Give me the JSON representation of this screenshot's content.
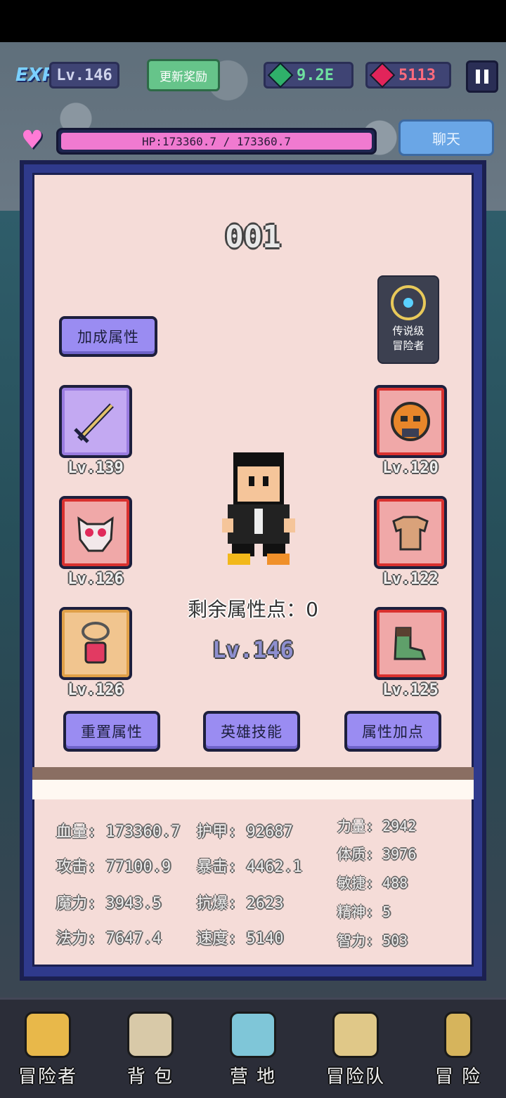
{
  "topbar": {
    "exp_label": "EXP",
    "level": "Lv.146",
    "update_reward": "更新奖励",
    "green_gems": "9.2E",
    "red_gems": "5113",
    "hp": "HP:173360.7 / 173360.7",
    "chat": "聊天"
  },
  "panel": {
    "id": "001",
    "bonus_attr": "加成属性",
    "legend_line1": "传说级",
    "legend_line2": "冒险者",
    "remaining_points": "剩余属性点：0",
    "hero_level": "Lv.146",
    "reset_btn": "重置属性",
    "skill_btn": "英雄技能",
    "add_point_btn": "属性加点"
  },
  "equipment": {
    "weapon_lv": "Lv.139",
    "helmet_lv": "Lv.120",
    "mask_lv": "Lv.126",
    "armor_lv": "Lv.122",
    "necklace_lv": "Lv.126",
    "boots_lv": "Lv.125"
  },
  "stats": {
    "hp": "血量: 173360.7",
    "atk": "攻击: 77100.9",
    "magic": "魔力: 3943.5",
    "spell": "法力: 7647.4",
    "armor": "护甲: 92687",
    "crit": "暴击: 4462.1",
    "anticrit": "抗爆: 2623",
    "speed": "速度: 5140",
    "str": "力量: 2942",
    "con": "体质: 3976",
    "agi": "敏捷: 488",
    "spirit": "精神: 5",
    "int": "智力: 503"
  },
  "nav": [
    {
      "label": "冒险者"
    },
    {
      "label": "背 包"
    },
    {
      "label": "营 地"
    },
    {
      "label": "冒险队"
    },
    {
      "label": "冒 险"
    }
  ],
  "colors": {
    "panel_bg": "#f5dcd8",
    "panel_border": "#2f3a8c",
    "button_purple": "#9a8cf2",
    "hp_pink": "#f07ad0",
    "slot_red": "#d9312f"
  }
}
